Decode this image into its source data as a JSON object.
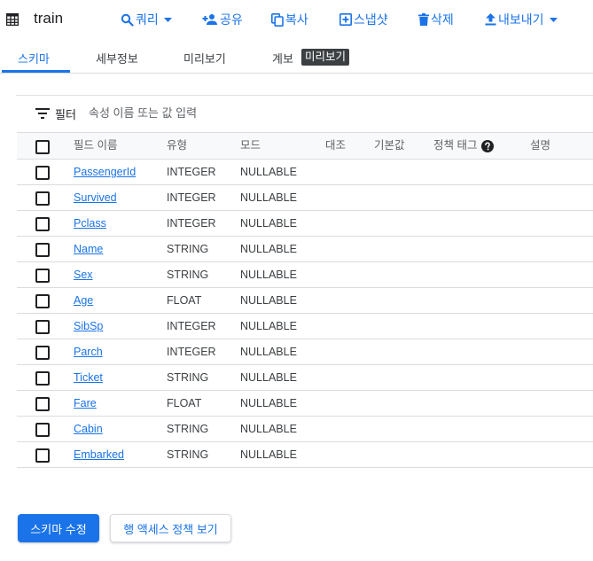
{
  "header": {
    "title": "train",
    "toolbar": [
      {
        "label": "쿼리",
        "icon": "search-icon",
        "dropdown": true
      },
      {
        "label": "공유",
        "icon": "person-add-icon",
        "dropdown": false
      },
      {
        "label": "복사",
        "icon": "copy-icon",
        "dropdown": false
      },
      {
        "label": "스냅샷",
        "icon": "snapshot-icon",
        "dropdown": false
      },
      {
        "label": "삭제",
        "icon": "trash-icon",
        "dropdown": false
      },
      {
        "label": "내보내기",
        "icon": "upload-icon",
        "dropdown": true
      }
    ]
  },
  "tabs": [
    {
      "label": "스키마",
      "active": true
    },
    {
      "label": "세부정보",
      "active": false
    },
    {
      "label": "미리보기",
      "active": false
    },
    {
      "label": "계보",
      "active": false
    }
  ],
  "badge": "미리보기",
  "filter": {
    "label": "필터",
    "placeholder": "속성 이름 또는 값 입력",
    "value": ""
  },
  "schema": {
    "columns": [
      "필드 이름",
      "유형",
      "모드",
      "대조",
      "기본값",
      "정책 태그",
      "설명"
    ],
    "rows": [
      {
        "name": "PassengerId",
        "type": "INTEGER",
        "mode": "NULLABLE"
      },
      {
        "name": "Survived",
        "type": "INTEGER",
        "mode": "NULLABLE"
      },
      {
        "name": "Pclass",
        "type": "INTEGER",
        "mode": "NULLABLE"
      },
      {
        "name": "Name",
        "type": "STRING",
        "mode": "NULLABLE"
      },
      {
        "name": "Sex",
        "type": "STRING",
        "mode": "NULLABLE"
      },
      {
        "name": "Age",
        "type": "FLOAT",
        "mode": "NULLABLE"
      },
      {
        "name": "SibSp",
        "type": "INTEGER",
        "mode": "NULLABLE"
      },
      {
        "name": "Parch",
        "type": "INTEGER",
        "mode": "NULLABLE"
      },
      {
        "name": "Ticket",
        "type": "STRING",
        "mode": "NULLABLE"
      },
      {
        "name": "Fare",
        "type": "FLOAT",
        "mode": "NULLABLE"
      },
      {
        "name": "Cabin",
        "type": "STRING",
        "mode": "NULLABLE"
      },
      {
        "name": "Embarked",
        "type": "STRING",
        "mode": "NULLABLE"
      }
    ]
  },
  "actions": {
    "edit_schema": "스키마 수정",
    "row_access_policy": "행 액세스 정책 보기"
  },
  "colors": {
    "accent": "#1a73e8",
    "text": "#202124",
    "muted": "#5f6368",
    "border": "#dadce0",
    "badge_bg": "#3c4043"
  }
}
